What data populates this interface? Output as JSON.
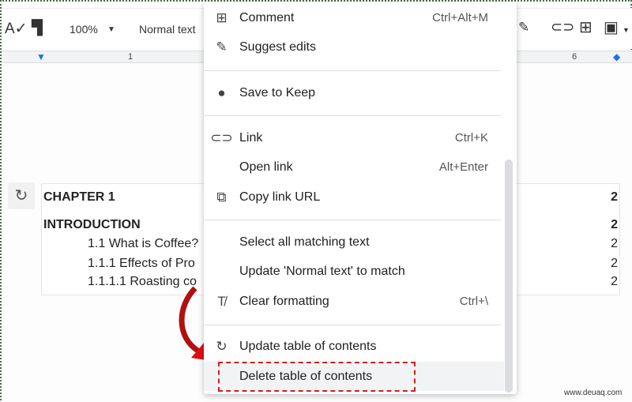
{
  "toolbar": {
    "zoom": "100%",
    "style": "Normal text",
    "icons": [
      "spellcheck-icon",
      "paint-format-icon",
      "pen-icon",
      "link-icon",
      "add-comment-icon",
      "image-icon"
    ]
  },
  "ruler": {
    "mark1": "1",
    "mark6": "6"
  },
  "toc": {
    "entries": [
      {
        "text": "CHAPTER 1",
        "page": "2"
      },
      {
        "text": "INTRODUCTION",
        "page": "2"
      },
      {
        "text": "1.1 What is Coffee?",
        "page": "2"
      },
      {
        "text": "1.1.1 Effects of Pro",
        "page": "2"
      },
      {
        "text": "1.1.1.1 Roasting co",
        "page": "2"
      }
    ]
  },
  "menu": {
    "items": [
      {
        "label": "Comment",
        "shortcut": "Ctrl+Alt+M",
        "icon": "add-comment-icon"
      },
      {
        "label": "Suggest edits",
        "shortcut": "",
        "icon": "suggest-edits-icon"
      },
      {
        "label": "Save to Keep",
        "shortcut": "",
        "icon": "keep-bulb-icon"
      },
      {
        "label": "Link",
        "shortcut": "Ctrl+K",
        "icon": "link-icon"
      },
      {
        "label": "Open link",
        "shortcut": "Alt+Enter",
        "icon": ""
      },
      {
        "label": "Copy link URL",
        "shortcut": "",
        "icon": "copy-icon"
      },
      {
        "label": "Select all matching text",
        "shortcut": "",
        "icon": ""
      },
      {
        "label": "Update 'Normal text' to match",
        "shortcut": "",
        "icon": ""
      },
      {
        "label": "Clear formatting",
        "shortcut": "Ctrl+\\",
        "icon": "clear-formatting-icon"
      },
      {
        "label": "Update table of contents",
        "shortcut": "",
        "icon": "refresh-icon"
      },
      {
        "label": "Delete table of contents",
        "shortcut": "",
        "icon": ""
      }
    ]
  },
  "annotation": {
    "color": "#d32020"
  },
  "watermark": "www.deuaq.com"
}
